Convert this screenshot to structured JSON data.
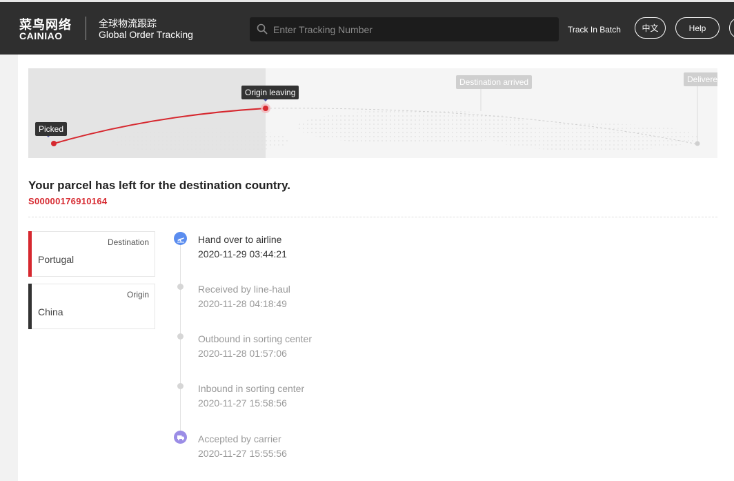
{
  "header": {
    "logo_cn": "菜鸟网络",
    "logo_en": "CAINIAO",
    "subtitle_cn": "全球物流跟踪",
    "subtitle_en": "Global Order Tracking",
    "search_placeholder": "Enter Tracking Number",
    "track_batch": "Track In Batch",
    "lang_button": "中文",
    "help_button": "Help"
  },
  "route": {
    "stages": [
      "Picked",
      "Origin leaving",
      "Destination arrived",
      "Delivere"
    ],
    "progress_stage_index": 1
  },
  "status": {
    "message": "Your parcel has left for the destination country.",
    "tracking_number": "S00000176910164"
  },
  "countries": {
    "destination_label": "Destination",
    "destination": "Portugal",
    "origin_label": "Origin",
    "origin": "China"
  },
  "events": [
    {
      "title": "Hand over to airline",
      "time": "2020-11-29 03:44:21",
      "icon": "airplane-icon"
    },
    {
      "title": "Received by line-haul",
      "time": "2020-11-28 04:18:49",
      "icon": ""
    },
    {
      "title": "Outbound in sorting center",
      "time": "2020-11-28 01:57:06",
      "icon": ""
    },
    {
      "title": "Inbound in sorting center",
      "time": "2020-11-27 15:58:56",
      "icon": ""
    },
    {
      "title": "Accepted by carrier",
      "time": "2020-11-27 15:55:56",
      "icon": "truck-icon"
    }
  ],
  "colors": {
    "accent_red": "#d6282f",
    "header_bg": "#2f2f2f",
    "airline_icon": "#5b8def",
    "carrier_icon": "#9b8de6"
  }
}
